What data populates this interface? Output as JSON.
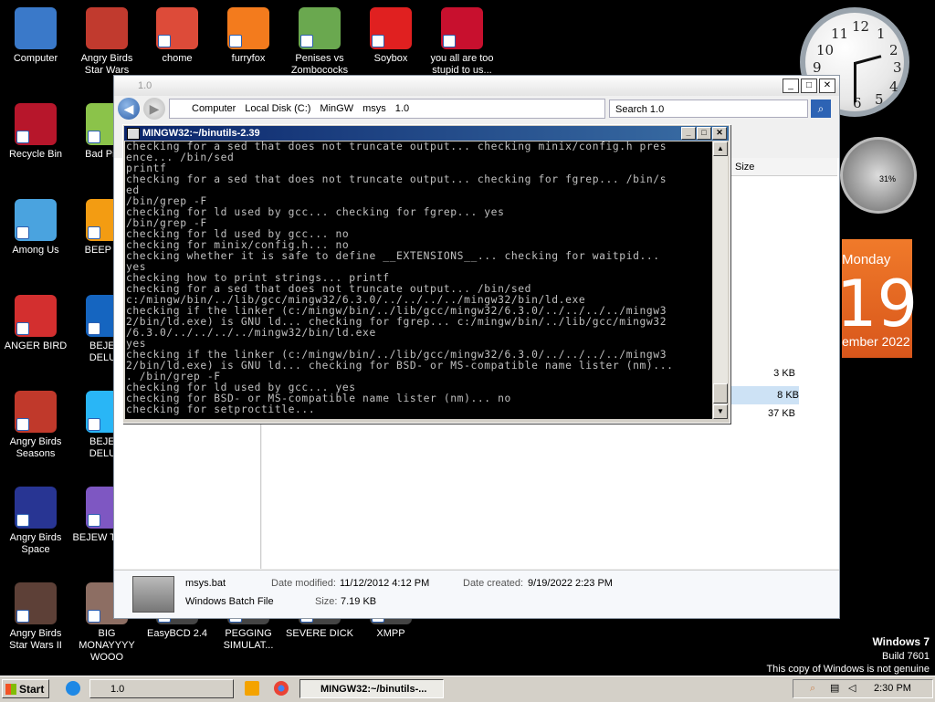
{
  "desktop": {
    "icons": [
      {
        "label": "Computer",
        "color": "#3a79c9"
      },
      {
        "label": "Angry Birds Star Wars",
        "color": "#c13a2e"
      },
      {
        "label": "chome",
        "color": "#dd4b39"
      },
      {
        "label": "furryfox",
        "color": "#f37b1d"
      },
      {
        "label": "Penises vs Zombococks",
        "color": "#6aa84f"
      },
      {
        "label": "Soybox",
        "color": "#e02020"
      },
      {
        "label": "you all are too stupid to us...",
        "color": "#c8102e"
      },
      {
        "label": "Recycle Bin",
        "color": "#b7162b"
      },
      {
        "label": "Bad Pig...",
        "color": "#8bc34a"
      },
      {
        "label": "Among Us",
        "color": "#4aa3df"
      },
      {
        "label": "BEEP B...",
        "color": "#f39c12"
      },
      {
        "label": "ANGER BIRD",
        "color": "#d32f2f"
      },
      {
        "label": "BEJEW DELU...",
        "color": "#1565c0"
      },
      {
        "label": "Angry Birds Seasons",
        "color": "#c0392b"
      },
      {
        "label": "BEJEW DELU...",
        "color": "#29b6f6"
      },
      {
        "label": "Angry Birds Space",
        "color": "#283593"
      },
      {
        "label": "BEJEW TWIST",
        "color": "#7e57c2"
      },
      {
        "label": "Angry Birds Star Wars II",
        "color": "#5d4037"
      },
      {
        "label": "BIG MONAYYYY WOOO",
        "color": "#8d6e63"
      },
      {
        "label": "EasyBCD 2.4",
        "color": "#444"
      },
      {
        "label": "PEGGING SIMULAT...",
        "color": "#444"
      },
      {
        "label": "SEVERE DICK",
        "color": "#444"
      },
      {
        "label": "XMPP",
        "color": "#444"
      }
    ]
  },
  "gadgets": {
    "clock": {
      "numbers": [
        "12",
        "1",
        "2",
        "3",
        "4",
        "5",
        "6",
        "7",
        "8",
        "9",
        "10",
        "11"
      ]
    },
    "gauge_label": "31%",
    "calendar": {
      "day": "Monday",
      "date": "19",
      "month": "ember 2022"
    }
  },
  "explorer": {
    "title": "1.0",
    "breadcrumb": [
      "Computer",
      "Local Disk (C:)",
      "MinGW",
      "msys",
      "1.0"
    ],
    "search_placeholder": "Search 1.0",
    "column_size": "Size",
    "sizes": [
      "3 KB",
      "8 KB",
      "37 KB"
    ],
    "details": {
      "filename": "msys.bat",
      "filetype": "Windows Batch File",
      "date_modified_label": "Date modified:",
      "date_modified": "11/12/2012 4:12 PM",
      "date_created_label": "Date created:",
      "date_created": "9/19/2022 2:23 PM",
      "size_label": "Size:",
      "size": "7.19 KB"
    }
  },
  "terminal": {
    "title": "MINGW32:~/binutils-2.39",
    "lines": [
      "checking for a sed that does not truncate output... checking minix/config.h pres",
      "ence... /bin/sed",
      "printf",
      "checking for a sed that does not truncate output... checking for fgrep... /bin/s",
      "ed",
      "/bin/grep -F",
      "checking for ld used by gcc... checking for fgrep... yes",
      "/bin/grep -F",
      "checking for ld used by gcc... no",
      "checking for minix/config.h... no",
      "checking whether it is safe to define __EXTENSIONS__... checking for waitpid...",
      "yes",
      "checking how to print strings... printf",
      "checking for a sed that does not truncate output... /bin/sed",
      "c:/mingw/bin/../lib/gcc/mingw32/6.3.0/../../../../mingw32/bin/ld.exe",
      "checking if the linker (c:/mingw/bin/../lib/gcc/mingw32/6.3.0/../../../../mingw3",
      "2/bin/ld.exe) is GNU ld... checking for fgrep... c:/mingw/bin/../lib/gcc/mingw32",
      "/6.3.0/../../../../mingw32/bin/ld.exe",
      "yes",
      "checking if the linker (c:/mingw/bin/../lib/gcc/mingw32/6.3.0/../../../../mingw3",
      "2/bin/ld.exe) is GNU ld... checking for BSD- or MS-compatible name lister (nm)...",
      ". /bin/grep -F",
      "checking for ld used by gcc... yes",
      "checking for BSD- or MS-compatible name lister (nm)... no",
      "checking for setproctitle..."
    ]
  },
  "watermark": {
    "os": "Windows 7",
    "build": "Build 7601",
    "notice": "This copy of Windows is not genuine"
  },
  "taskbar": {
    "start": "Start",
    "items": [
      "1.0",
      "MINGW32:~/binutils-..."
    ],
    "time": "2:30 PM"
  }
}
